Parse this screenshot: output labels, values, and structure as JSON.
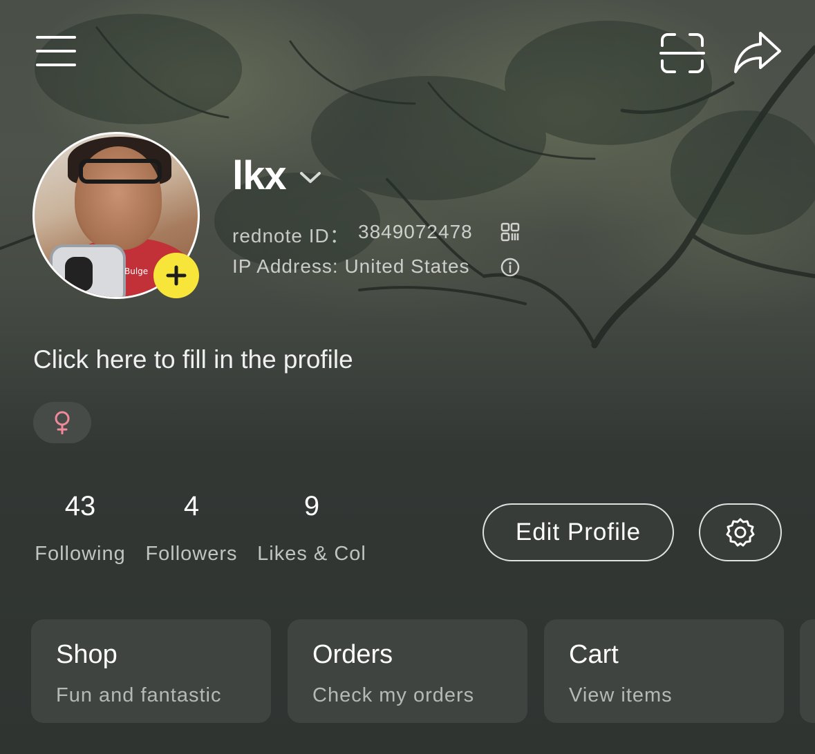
{
  "profile": {
    "username": "lkx",
    "id_label": "rednote ID：",
    "id_value": "3849072478",
    "ip_text": "IP Address: United States",
    "bio_prompt": "Click here to fill in the profile",
    "gender_symbol": "♀",
    "avatar_tag": "Bulge"
  },
  "stats": [
    {
      "value": "43",
      "label": "Following"
    },
    {
      "value": "4",
      "label": "Followers"
    },
    {
      "value": "9",
      "label": "Likes & Col"
    }
  ],
  "actions": {
    "edit_label": "Edit Profile"
  },
  "cards": [
    {
      "title": "Shop",
      "subtitle": "Fun and fantastic"
    },
    {
      "title": "Orders",
      "subtitle": "Check my orders"
    },
    {
      "title": "Cart",
      "subtitle": "View items"
    }
  ],
  "colors": {
    "accent_yellow": "#f7e539",
    "gender_pink": "#f08a9a",
    "background": "#2f3431",
    "card_bg": "#3f4441"
  },
  "icons": {
    "menu": "hamburger-menu-icon",
    "scan": "scan-icon",
    "share": "share-icon",
    "qr": "qr-code-icon",
    "info": "info-icon",
    "settings": "gear-icon",
    "add": "plus-icon",
    "dropdown": "chevron-down-icon"
  }
}
